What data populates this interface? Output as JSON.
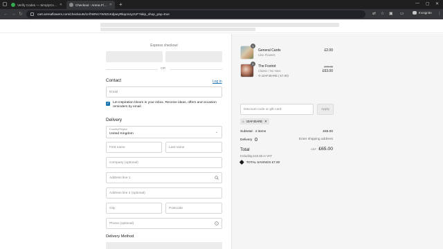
{
  "browser": {
    "tabs": [
      {
        "title": "Verify Codes — SimplyCodes",
        "favicon_color": "#34a853"
      },
      {
        "title": "Checkout - Arena Flowers",
        "favicon_color": "#8a8a8a"
      }
    ],
    "address_url": "cart.arenaflowers.com/checkouts/cn/hWN1YWIIZcKdjaeyRkqcsUyzUF?skip_shop_pay=true",
    "profile_label": "Incognito",
    "icons": [
      "tab-search-icon",
      "new-tab-icon",
      "back-icon",
      "forward-icon",
      "reload-icon",
      "site-settings-icon",
      "translate-icon",
      "bookmark-star-icon",
      "extensions-icon",
      "incognito-icon",
      "menu-kebab-icon",
      "minimize-icon",
      "maximize-icon",
      "close-icon"
    ]
  },
  "checkout": {
    "express_title": "Express checkout",
    "or_label": "OR",
    "contact": {
      "title": "Contact",
      "login_label": "Log in",
      "email_placeholder": "Email",
      "newsletter_label": "Let inspiration bloom in your inbox. Receive ideas, offers and occasion reminders by email.",
      "newsletter_checked": true
    },
    "delivery": {
      "title": "Delivery",
      "country_label": "Country/Region",
      "country_value": "United Kingdom",
      "first_name_placeholder": "First name",
      "last_name_placeholder": "Last name",
      "company_placeholder": "Company (optional)",
      "address1_placeholder": "Address line 1",
      "address2_placeholder": "Address line 2 (optional)",
      "city_placeholder": "City",
      "postcode_placeholder": "Postcode",
      "phone_placeholder": "Phone (optional)"
    },
    "delivery_method_title": "Delivery Method"
  },
  "summary": {
    "items": [
      {
        "name": "General Cards",
        "subtitle": "Lilac Flowers",
        "quantity": "1",
        "price": "£2.00"
      },
      {
        "name": "The Foxtrot",
        "subtitle": "Classic / No Vase",
        "quantity": "1",
        "original_price": "£70.00",
        "price": "£63.00",
        "discount": "10AF40ARE (-£7.00)"
      }
    ],
    "discount_placeholder": "Discount code or gift card",
    "apply_label": "Apply",
    "applied_code": "10AF40ARE",
    "subtotal_label": "Subtotal · 2 items",
    "subtotal_value": "£65.00",
    "delivery_label": "Delivery",
    "delivery_value": "Enter shipping address",
    "total_label": "Total",
    "currency": "GBP",
    "total_value": "£65.00",
    "vat_note": "Including £10.83 in VAT",
    "savings_label": "TOTAL SAVINGS",
    "savings_value": "£7.00"
  },
  "colors": {
    "link": "#1773b0",
    "chrome_dark": "#1f1f1f",
    "toolbar": "#35363a",
    "summary_bg": "#f5f5f5"
  }
}
